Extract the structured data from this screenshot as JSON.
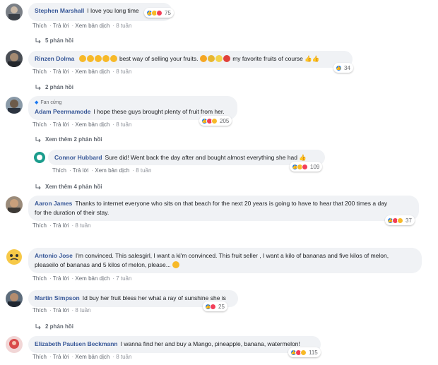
{
  "actions": {
    "like": "Thích",
    "reply": "Trả lời",
    "translate": "Xem bản dịch"
  },
  "comments": [
    {
      "name": "Stephen Marshall",
      "text": "I love you long time",
      "count": "75",
      "time": "8 tuần",
      "replies": "5 phản hồi"
    },
    {
      "name": "Rinzen Dolma",
      "text": "best way of selling your fruits.",
      "text2": "my favorite fruits of course",
      "count": "34",
      "time": "8 tuần",
      "replies": "2 phản hồi"
    },
    {
      "badge": "Fan cứng",
      "name": "Adam Peermamode",
      "text": "I hope these guys brought plenty of fruit from her.",
      "count": "205",
      "time": "8 tuần",
      "replies": "Xem thêm 2 phản hồi"
    },
    {
      "name": "Connor Hubbard",
      "text": "Sure did! Went back the day after and bought almost everything she had",
      "count": "109",
      "time": "8 tuần",
      "replies": "Xem thêm 4 phản hồi"
    },
    {
      "name": "Aaron James",
      "text": "Thanks to internet everyone who sits on that beach for the next 20 years is going to have to hear that 200 times a day",
      "text2": "for the duration of their stay.",
      "count": "37",
      "time": "8 tuần"
    },
    {
      "name": "Antonio Jose",
      "text": "I'm convinced. This salesgirl, I want a ki'm convinced. This fruit seller , I want a kilo of bananas and five kilos of melon,",
      "text2": "pleaseilo of bananas and 5 kilos of melon, please...",
      "time": "7 tuần"
    },
    {
      "name": "Martin Simpson",
      "text": "Id buy her fruit bless her what a ray of sunshine she is",
      "count": "25",
      "time": "8 tuần",
      "replies": "2 phản hồi"
    },
    {
      "name": "Elizabeth Paulsen Beckmann",
      "text": "I wanna find her and buy a Mango, pineapple, banana, watermelon!",
      "count": "115",
      "time": "8 tuần"
    }
  ]
}
